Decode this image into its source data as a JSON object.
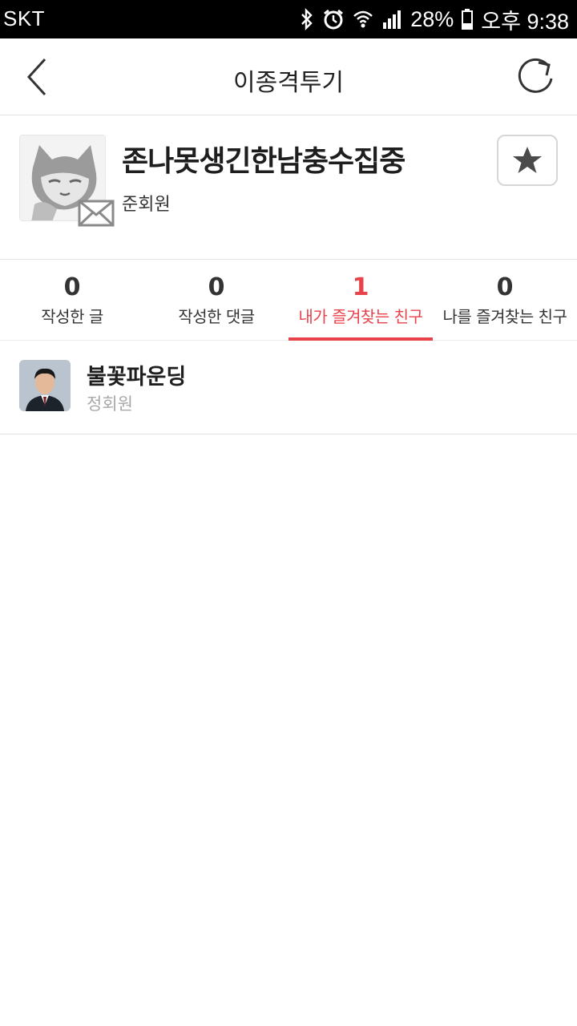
{
  "status_bar": {
    "carrier": "SKT",
    "battery": "28%",
    "time": "오후 9:38",
    "icons": [
      "bluetooth-icon",
      "alarm-icon",
      "wifi-icon",
      "signal-icon",
      "battery-icon"
    ]
  },
  "header": {
    "title": "이종격투기",
    "back_icon": "chevron-left-icon",
    "refresh_icon": "refresh-icon"
  },
  "profile": {
    "nickname": "존나못생긴한남충수집중",
    "grade": "준회원",
    "message_icon": "envelope-icon",
    "favorite_icon": "star-icon"
  },
  "stats": [
    {
      "count": "0",
      "label": "작성한 글",
      "active": false
    },
    {
      "count": "0",
      "label": "작성한 댓글",
      "active": false
    },
    {
      "count": "1",
      "label": "내가 즐겨찾는 친구",
      "active": true
    },
    {
      "count": "0",
      "label": "나를 즐겨찾는 친구",
      "active": false
    }
  ],
  "friends": [
    {
      "name": "불꽃파운딩",
      "grade": "정회원"
    }
  ],
  "colors": {
    "accent": "#e8424b",
    "text": "#222222",
    "muted": "#a8a8a8",
    "divider": "#e2e2e2"
  }
}
